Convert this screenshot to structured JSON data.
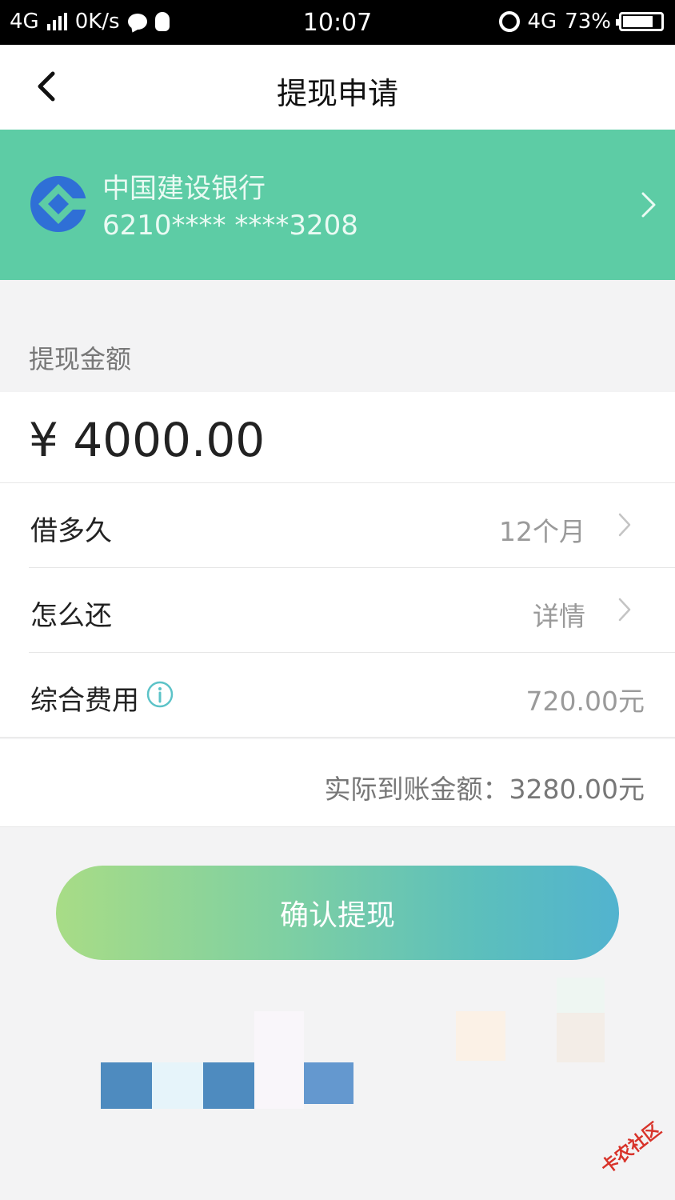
{
  "status_bar": {
    "network_left": "4G",
    "speed": "0K/s",
    "time": "10:07",
    "network_right": "4G",
    "battery": "73%"
  },
  "nav": {
    "title": "提现申请"
  },
  "bank_card": {
    "bank_name": "中国建设银行",
    "account_masked": "6210**** ****3208"
  },
  "withdraw": {
    "amount_label": "提现金额",
    "amount_value": "¥ 4000.00"
  },
  "rows": {
    "term": {
      "label": "借多久",
      "value": "12个月"
    },
    "repay": {
      "label": "怎么还",
      "value": "详情"
    },
    "fee": {
      "label": "综合费用",
      "value": "720.00元"
    }
  },
  "net_amount": {
    "label": "实际到账金额：",
    "value": "3280.00元"
  },
  "confirm_button": {
    "label": "确认提现"
  },
  "watermark": {
    "text": "卡农社区"
  },
  "colors": {
    "card_green": "#5dcca5",
    "button_start": "#a8dc86",
    "button_end": "#52b3cf",
    "bank_blue": "#2f6fd6"
  }
}
